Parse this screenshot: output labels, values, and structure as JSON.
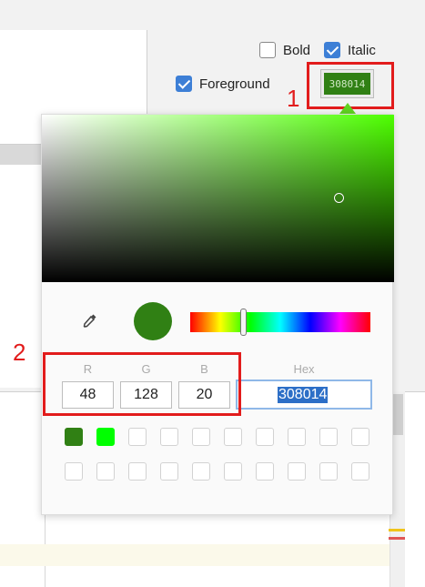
{
  "checkboxes": {
    "bold": {
      "label": "Bold",
      "checked": false
    },
    "italic": {
      "label": "Italic",
      "checked": true
    },
    "foreground": {
      "label": "Foreground",
      "checked": true
    }
  },
  "color_button": {
    "value": "308014",
    "color": "#308014"
  },
  "annotations": {
    "one": "1",
    "two": "2"
  },
  "picker": {
    "labels": {
      "r": "R",
      "g": "G",
      "b": "B",
      "hex": "Hex"
    },
    "values": {
      "r": "48",
      "g": "128",
      "b": "20",
      "hex": "308014"
    },
    "preview_color": "#308014",
    "recent_colors": [
      "#308014",
      "#00ff00"
    ]
  }
}
